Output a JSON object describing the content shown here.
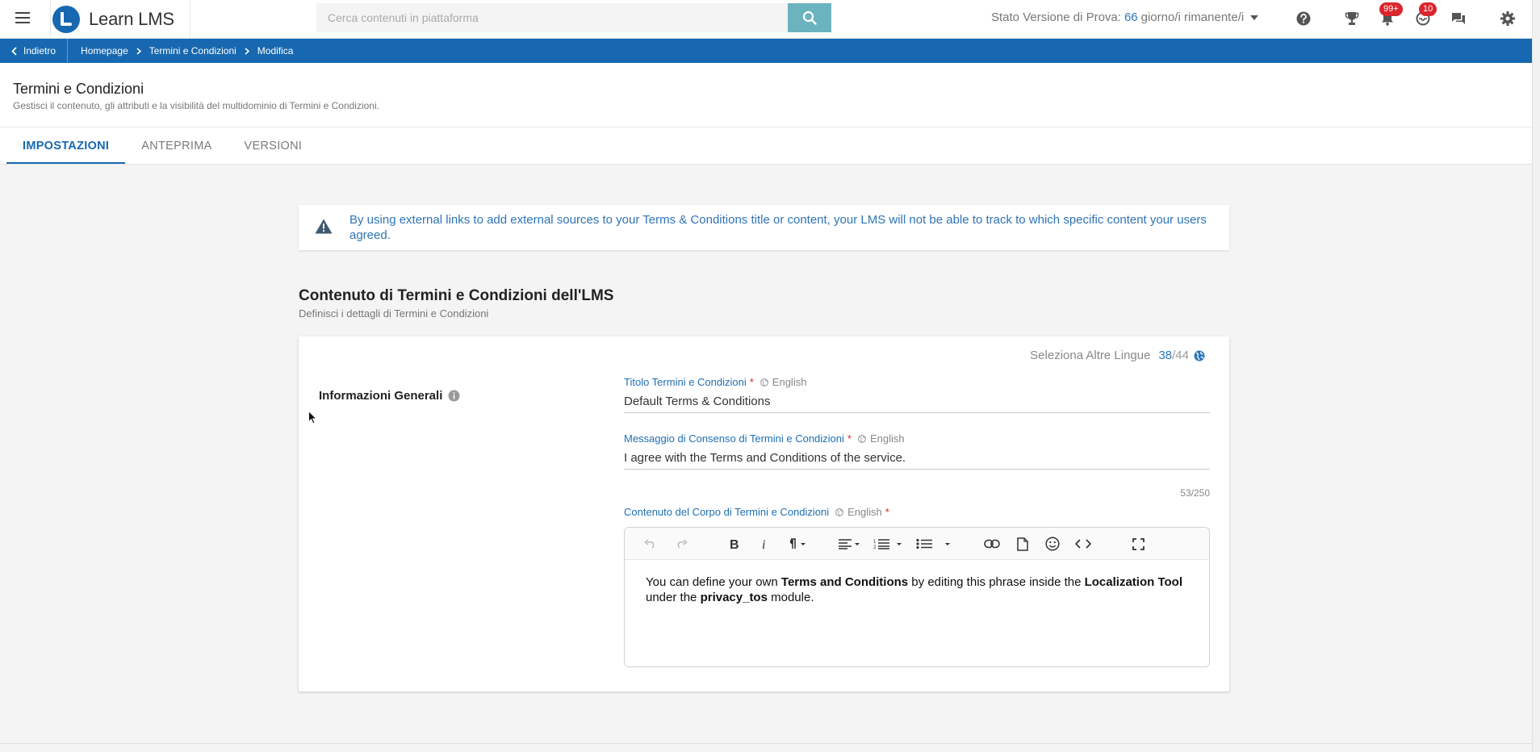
{
  "topbar": {
    "logo_text": "Learn LMS",
    "search_placeholder": "Cerca contenuti in piattaforma",
    "trial_prefix": "Stato Versione di Prova:",
    "trial_days": "66",
    "trial_suffix": "giorno/i rimanente/i",
    "notifications_badge": "99+",
    "messages_badge": "10",
    "icons": [
      "menu-icon",
      "search-icon",
      "help-icon",
      "trophy-icon",
      "bell-icon",
      "inbox-icon",
      "chat-icon",
      "gear-icon"
    ]
  },
  "breadcrumb": {
    "back_label": "Indietro",
    "items": [
      "Homepage",
      "Termini e Condizioni",
      "Modifica"
    ]
  },
  "header": {
    "title": "Termini e Condizioni",
    "subtitle": "Gestisci il contenuto, gli attributi e la visibilità del multidominio di Termini e Condizioni."
  },
  "tabs": [
    {
      "label": "IMPOSTAZIONI",
      "active": true
    },
    {
      "label": "ANTEPRIMA",
      "active": false
    },
    {
      "label": "VERSIONI",
      "active": false
    }
  ],
  "alert": {
    "text": "By using external links to add external sources to your Terms & Conditions title or content, your LMS will not be able to track to which specific content your users agreed."
  },
  "section": {
    "title": "Contenuto di Termini e Condizioni dell'LMS",
    "subtitle": "Definisci i dettagli di Termini e Condizioni"
  },
  "card": {
    "lang_select_label": "Seleziona Altre Lingue",
    "lang_count": "38",
    "lang_total": "/44",
    "general_label": "Informazioni Generali",
    "title_field": {
      "label": "Titolo Termini e Condizioni",
      "required": "*",
      "language": "English",
      "value": "Default Terms & Conditions"
    },
    "consent_field": {
      "label": "Messaggio di Consenso di Termini e Condizioni",
      "required": "*",
      "language": "English",
      "value": "I agree with the Terms and Conditions of the service.",
      "char_count": "53/250"
    },
    "body_field": {
      "label": "Contenuto del Corpo di Termini e Condizioni",
      "language": "English",
      "required": "*",
      "content": {
        "t1": "You can define your own ",
        "b1": "Terms and Conditions",
        "t2": " by editing this phrase inside the ",
        "b2": "Localization Tool",
        "t3": " under the ",
        "b3": "privacy_tos",
        "t4": " module."
      }
    }
  },
  "colors": {
    "primary": "#1768b0",
    "search_button": "#6bb3be",
    "badge": "#d9262c",
    "label_blue": "#1f6fb3"
  }
}
